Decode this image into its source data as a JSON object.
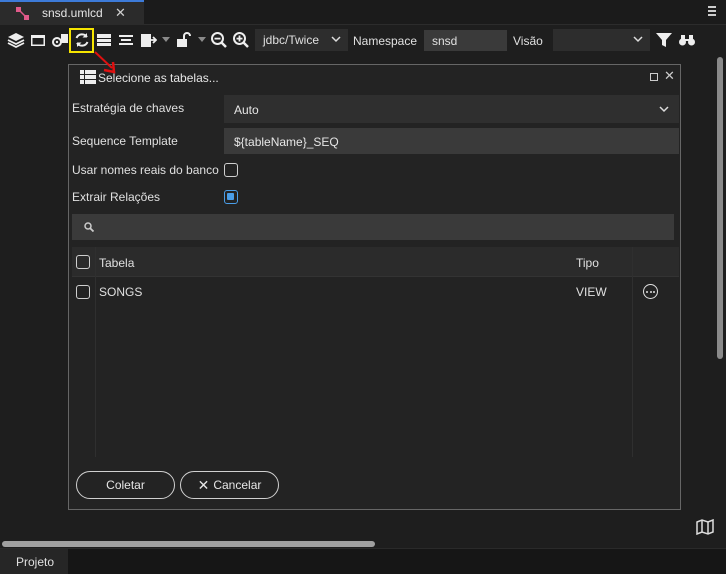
{
  "tab": {
    "title": "snsd.umlcd",
    "close": "✕"
  },
  "toolbar": {
    "connection_value": "jdbc/Twice",
    "namespace_label": "Namespace",
    "namespace_value": "snsd",
    "visao_label": "Visão",
    "visao_value": ""
  },
  "dialog": {
    "title": "Selecione as tabelas...",
    "close": "✕",
    "key_strategy_label": "Estratégia de chaves",
    "key_strategy_value": "Auto",
    "sequence_label": "Sequence Template",
    "sequence_value": "${tableName}_SEQ",
    "real_names_label": "Usar nomes reais do banco",
    "real_names_checked": false,
    "extract_relations_label": "Extrair Relações",
    "extract_relations_checked": true,
    "search_value": "",
    "table": {
      "columns": [
        "Tabela",
        "Tipo"
      ],
      "rows": [
        {
          "name": "SONGS",
          "type": "VIEW",
          "checked": false
        }
      ]
    },
    "collect_button": "Coletar",
    "cancel_button": "Cancelar",
    "cancel_icon": "✕"
  },
  "bottom": {
    "tab_label": "Projeto"
  },
  "colors": {
    "accent": "#3d7bd9",
    "highlight": "#f5e400",
    "arrow": "#e01010",
    "checkbox_checked": "#4a9ee8"
  }
}
